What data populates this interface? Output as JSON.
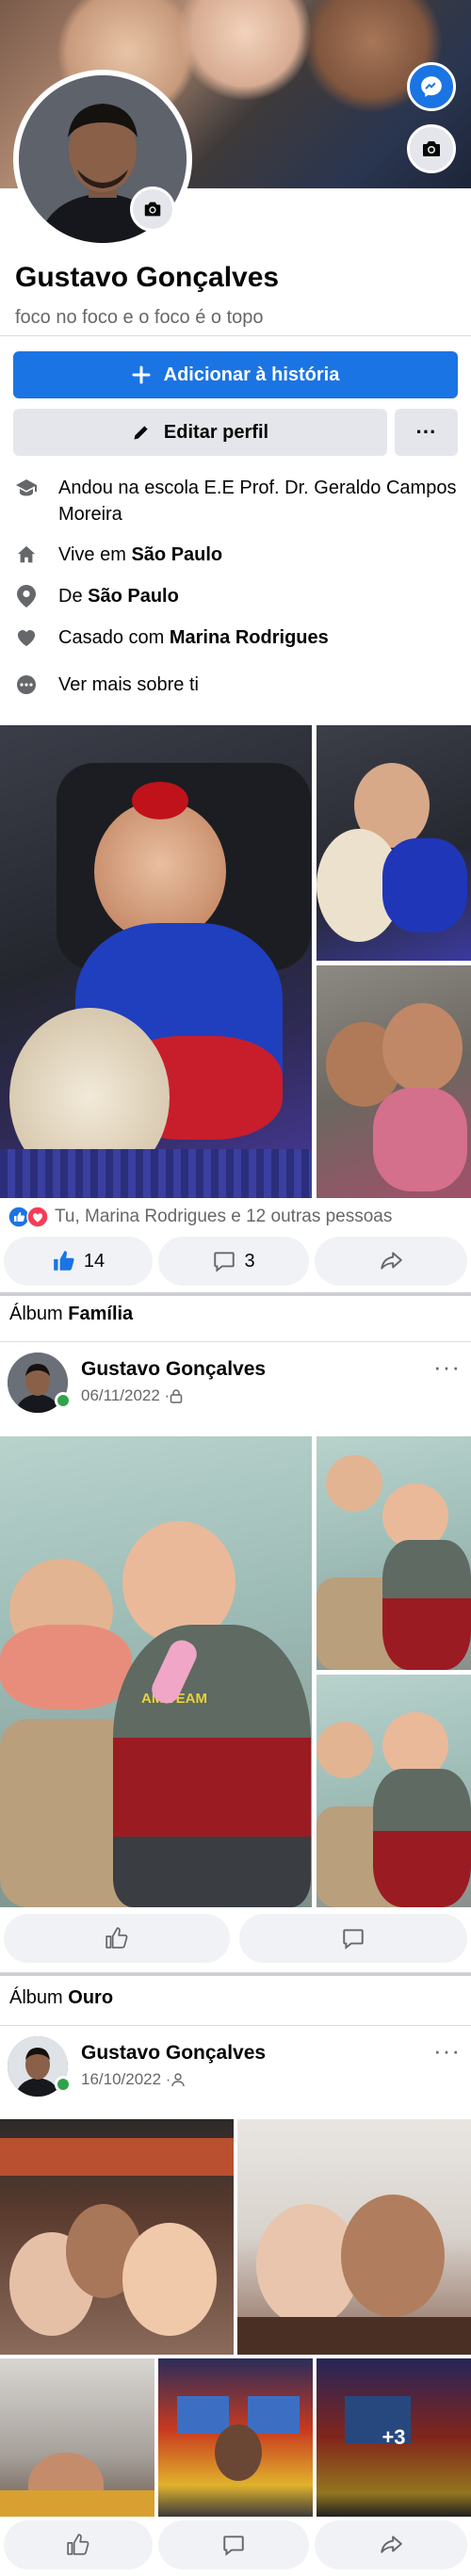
{
  "profile": {
    "name": "Gustavo Gonçalves",
    "bio": "foco no foco e o foco é o topo"
  },
  "actions": {
    "add_story_label": "Adicionar à história",
    "edit_profile_label": "Editar perfil",
    "more_label": "···"
  },
  "details": {
    "school": "Andou na escola E.E Prof. Dr. Geraldo Campos Moreira",
    "lives_prefix": "Vive em",
    "lives_city": "São Paulo",
    "from_prefix": "De",
    "from_city": "São Paulo",
    "relationship_prefix": "Casado com",
    "relationship_partner": "Marina Rodrigues",
    "see_more": "Ver mais sobre ti"
  },
  "featured": {
    "reactions_text": "Tu, Marina Rodrigues e 12 outras pessoas",
    "like_count": "14",
    "comment_count": "3"
  },
  "post1": {
    "album_prefix": "Álbum",
    "album_name": "Família",
    "author": "Gustavo Gonçalves",
    "date": "06/11/2022 · ",
    "menu": "···",
    "shirt_text": "AM TEAM"
  },
  "post2": {
    "album_prefix": "Álbum",
    "album_name": "Ouro",
    "author": "Gustavo Gonçalves",
    "date": "16/10/2022 · ",
    "menu": "···",
    "more_photos": "+3"
  },
  "icons": {
    "camera": "camera-icon",
    "messenger": "messenger-icon",
    "plus": "plus-icon",
    "pencil": "pencil-icon",
    "school": "graduation-cap-icon",
    "home": "home-icon",
    "pin": "location-pin-icon",
    "heart": "heart-icon",
    "more": "ellipsis-icon",
    "like": "thumbs-up-icon",
    "comment": "comment-icon",
    "share": "share-icon",
    "lock": "lock-icon",
    "friends": "friends-icon"
  },
  "colors": {
    "accent": "#1b74e4",
    "text": "#050505",
    "secondary_text": "#65676b",
    "button_gray": "#e4e6eb",
    "online": "#31a24c",
    "love": "#f33e58"
  }
}
